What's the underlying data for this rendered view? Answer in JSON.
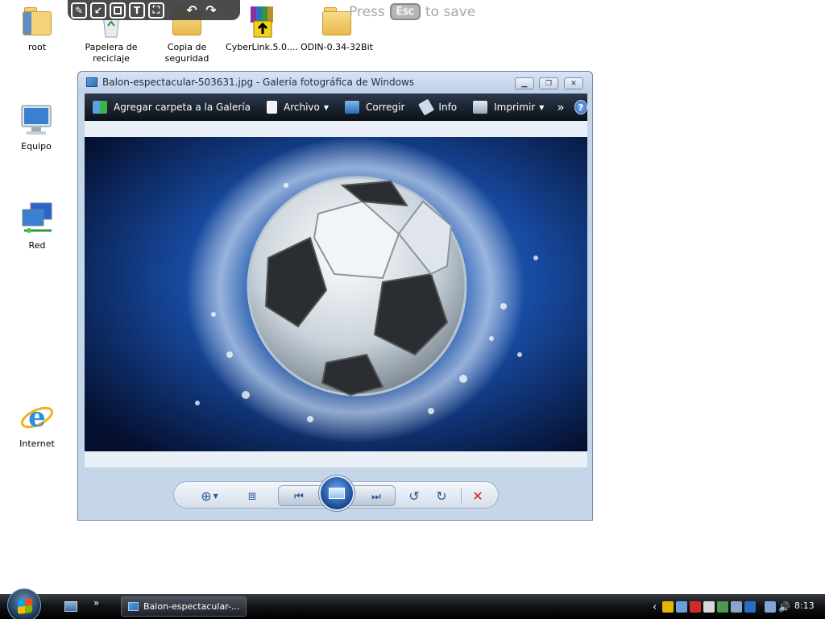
{
  "desktop_icons": [
    {
      "label": "root",
      "icon": "user-folder-icon"
    },
    {
      "label": "Papelera de reciclaje",
      "icon": "recycle-bin-icon"
    },
    {
      "label": "Copia de seguridad",
      "icon": "folder-icon"
    },
    {
      "label": "CyberLink.5.0....",
      "icon": "archive-icon"
    },
    {
      "label": "ODIN-0.34-32Bit",
      "icon": "folder-icon"
    },
    {
      "label": "Equipo",
      "icon": "computer-icon"
    },
    {
      "label": "Red",
      "icon": "network-icon"
    },
    {
      "label": "Internet",
      "icon": "internet-explorer-icon"
    }
  ],
  "annotation_toolbar": {
    "tools": [
      "pencil-icon",
      "arrow-icon",
      "rectangle-icon",
      "text-icon",
      "crop-icon",
      "undo-icon",
      "redo-icon"
    ],
    "text_tool_glyph": "T",
    "press_label": "Press",
    "key_label": "Esc",
    "save_label": "to save"
  },
  "window": {
    "title": "Balon-espectacular-503631.jpg - Galería fotográfica de Windows",
    "menu": {
      "add_folder": "Agregar carpeta a la Galería",
      "file": "Archivo",
      "fix": "Corregir",
      "info": "Info",
      "print": "Imprimir",
      "more": "»",
      "help": "?"
    },
    "photo_subject": "soccer ball splashing in water",
    "controls": [
      "zoom-icon",
      "fit-window-icon",
      "previous-icon",
      "slideshow-icon",
      "next-icon",
      "rotate-left-icon",
      "rotate-right-icon",
      "delete-icon"
    ]
  },
  "taskbar": {
    "task_button": "Balon-espectacular-...",
    "quick_launch_more": "»",
    "tray_expand": "‹",
    "clock": "8:13"
  },
  "colors": {
    "menubar": "#0b1119",
    "photo_background": "#0d2e73",
    "delete": "#cc2222"
  }
}
